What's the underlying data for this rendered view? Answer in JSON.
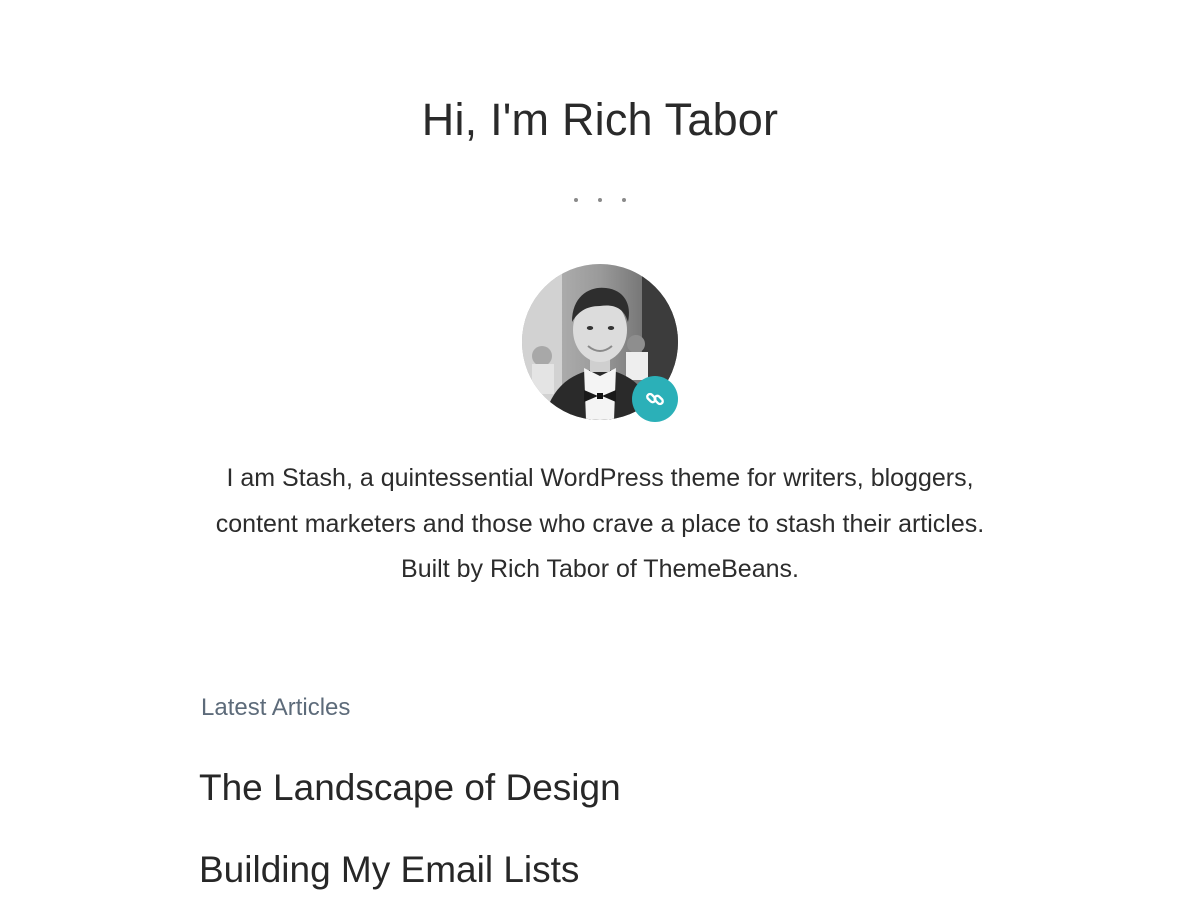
{
  "hero": {
    "title": "Hi, I'm Rich Tabor"
  },
  "profile": {
    "avatar_icon": "person-portrait",
    "badge_icon": "link-icon",
    "badge_color": "#2bb0b8"
  },
  "bio": {
    "text": "I am Stash, a quintessential WordPress theme for writers, bloggers, content marketers and those who crave a place to stash their articles. Built by Rich Tabor of ThemeBeans."
  },
  "latest": {
    "label": "Latest Articles",
    "articles": [
      {
        "title": "The Landscape of Design"
      },
      {
        "title": "Building My Email Lists"
      }
    ]
  }
}
